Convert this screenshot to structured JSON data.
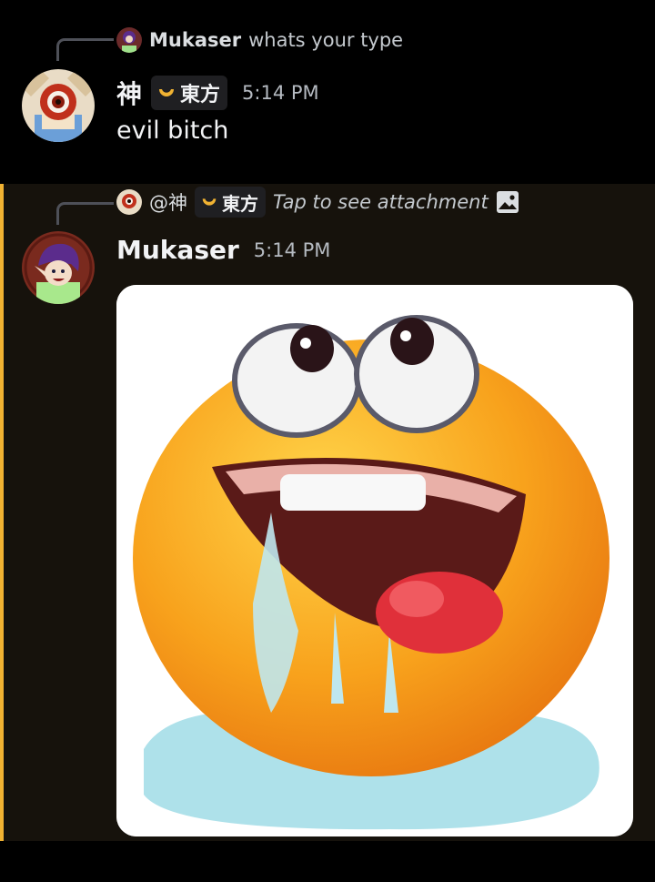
{
  "messages": [
    {
      "reply": {
        "username": "Mukaser",
        "text": "whats your type"
      },
      "author": "神",
      "role_tag": "東方",
      "timestamp": "5:14 PM",
      "text": "evil bitch"
    },
    {
      "reply": {
        "mention": "@神",
        "role_tag": "東方",
        "text": "Tap to see attachment"
      },
      "author": "Mukaser",
      "timestamp": "5:14 PM",
      "attachment": {
        "type": "gif",
        "icon": "drooling-emoji-gif"
      }
    }
  ],
  "colors": {
    "mention_bar": "#f0b232",
    "mention_bg": "#16120c",
    "role_crescent": "#f0b232"
  }
}
